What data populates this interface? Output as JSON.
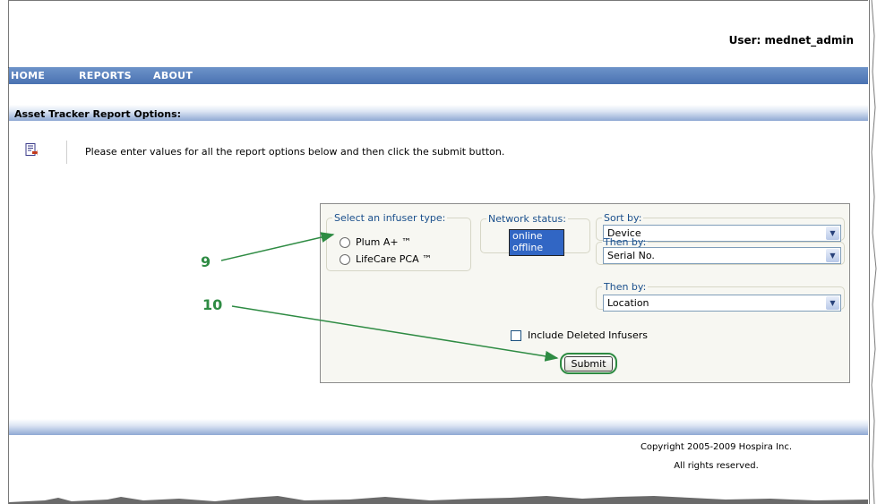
{
  "header": {
    "user_label": "User: mednet_admin"
  },
  "nav": {
    "home": "HOME",
    "reports": "REPORTS",
    "about": "ABOUT"
  },
  "section": {
    "title": "Asset Tracker Report Options:"
  },
  "instructions": "Please enter values for all the report options below and then click the submit button.",
  "form": {
    "infuser_legend": "Select an infuser type:",
    "infuser_options": [
      "Plum A+ ™",
      "LifeCare PCA ™"
    ],
    "network_legend": "Network status:",
    "network_options": [
      "online",
      "offline"
    ],
    "sort_legend": "Sort by:",
    "sort_value": "Device",
    "then1_legend": "Then by:",
    "then1_value": "Serial No.",
    "then2_legend": "Then by:",
    "then2_value": "Location",
    "include_deleted_label": "Include Deleted Infusers",
    "submit_label": "Submit"
  },
  "annotations": {
    "a9": "9",
    "a10": "10",
    "color": "#2e8b43"
  },
  "footer": {
    "copyright": "Copyright 2005-2009 Hospira Inc.",
    "rights": "All rights reserved."
  },
  "colors": {
    "nav_bar": "#4a72b2",
    "legend_text": "#1a4f8c",
    "listbox_selected": "#3166c4"
  },
  "icons": {
    "report": "report-document-icon",
    "dropdown": "chevron-down-icon"
  }
}
